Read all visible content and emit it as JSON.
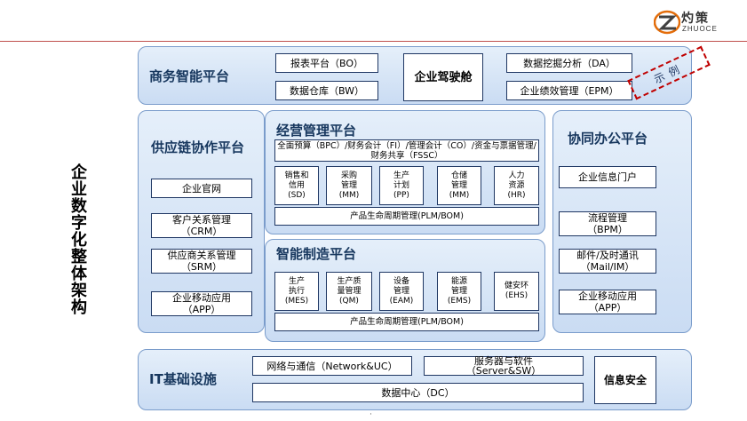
{
  "logo": {
    "cn": "灼策",
    "en": "ZHUOCE"
  },
  "side_title": "企业数字化整体架构",
  "bi": {
    "title": "商务智能平台",
    "items": [
      "报表平台（BO）",
      "数据仓库（BW）",
      "企业驾驶舱",
      "数据挖掘分析（DA）",
      "企业绩效管理（EPM）"
    ],
    "sample": "示例"
  },
  "scm": {
    "title": "供应链协作平台",
    "items": [
      "企业官网",
      "客户关系管理\n（CRM）",
      "供应商关系管理\n（SRM）",
      "企业移动应用\n（APP）"
    ]
  },
  "erp": {
    "title": "经营管理平台",
    "top": "全面预算（BPC）/财务会计（FI）/管理会计（CO）/资金与票据管理/财务共享（FSSC）",
    "modules": [
      "销售和\n信用\n(SD)",
      "采购\n管理\n(MM)",
      "生产\n计划\n(PP)",
      "仓储\n管理\n(MM)",
      "人力\n资源\n(HR)"
    ],
    "bottom": "产品生命周期管理(PLM/BOM)"
  },
  "mfg": {
    "title": "智能制造平台",
    "modules": [
      "生产\n执行\n(MES)",
      "生产质\n量管理\n(QM)",
      "设备\n管理\n(EAM)",
      "能源\n管理\n(EMS)",
      "健安环\n(EHS)"
    ],
    "bottom": "产品生命周期管理(PLM/BOM)"
  },
  "oa": {
    "title": "协同办公平台",
    "items": [
      "企业信息门户",
      "流程管理\n（BPM）",
      "邮件/及时通讯\n（Mail/IM）",
      "企业移动应用\n（APP）"
    ]
  },
  "infra": {
    "title": "IT基础设施",
    "network": "网络与通信（Network&UC）",
    "server": "服务器与软件\n（Server&SW）",
    "dc": "数据中心（DC）",
    "security": "信息安全"
  },
  "colors": {
    "accent": "#c0504d",
    "panel": "#dbe7f6",
    "border": "#1f3763",
    "title": "#17375e"
  }
}
